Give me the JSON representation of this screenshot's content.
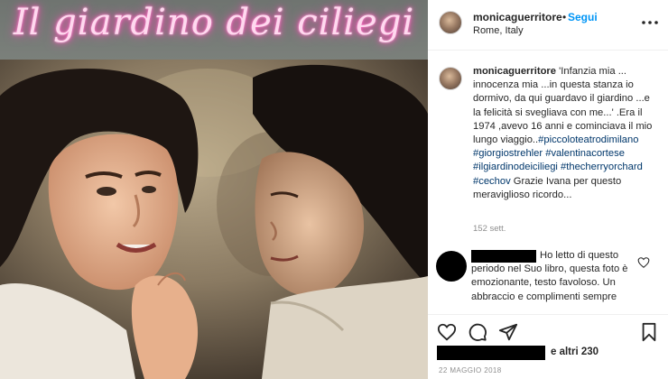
{
  "image_overlay": {
    "title": "Il giardino dei ciliegi"
  },
  "header": {
    "username": "monicaguerritore",
    "separator": "•",
    "follow_label": "Segui",
    "location": "Rome, Italy",
    "more_icon": "more-horizontal-icon"
  },
  "caption": {
    "username": "monicaguerritore",
    "text": "'Infanzia mia ... innocenza mia ...in questa stanza io dormivo, da qui guardavo il giardino ...e la felicità si svegliava con me...' .Era il 1974 ,avevo 16 anni e cominciava il mio lungo viaggio..",
    "tags": [
      "#piccoloteatrodimilano",
      "#giorgiostrehler",
      "#valentinacortese",
      "#ilgiardinodeiciliegi",
      "#thecherryorchard",
      "#cechov"
    ],
    "tail": "Grazie Ivana per questo meraviglioso ricordo...",
    "time_ago": "152 sett."
  },
  "comment": {
    "text": "Ho letto di questo periodo nel Suo libro, questa foto è emozionante, testo favoloso. Un abbraccio e complimenti sempre",
    "like_icon": "heart-outline-icon"
  },
  "actions": {
    "like_icon": "heart-icon",
    "comment_icon": "comment-icon",
    "share_icon": "share-icon",
    "save_icon": "bookmark-icon"
  },
  "likes": {
    "text": "e altri 230"
  },
  "post_date": "22 MAGGIO 2018",
  "colors": {
    "link_blue": "#0095f6",
    "hashtag": "#00376b",
    "neon_pink": "#ff4fb8",
    "muted": "#8e8e8e"
  }
}
